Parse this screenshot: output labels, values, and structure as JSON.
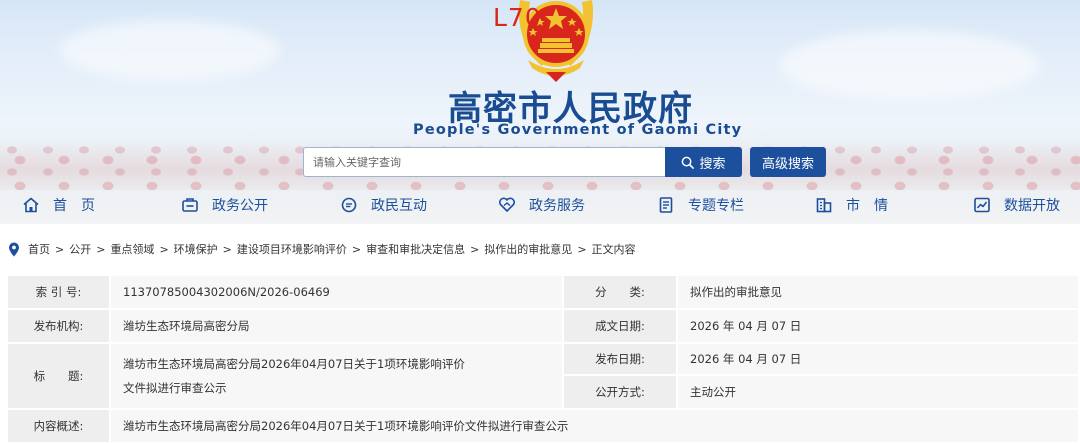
{
  "header": {
    "watermark": "L70",
    "title": "高密市人民政府",
    "subtitle": "People's Government of Gaomi City",
    "search": {
      "placeholder": "请输入关键字查询",
      "button_label": "搜索",
      "advanced_label": "高级搜索"
    }
  },
  "nav": [
    {
      "label": "首　页",
      "icon": "home-icon"
    },
    {
      "label": "政务公开",
      "icon": "folder-icon"
    },
    {
      "label": "政民互动",
      "icon": "chat-icon"
    },
    {
      "label": "政务服务",
      "icon": "service-icon"
    },
    {
      "label": "专题专栏",
      "icon": "document-icon"
    },
    {
      "label": "市　情",
      "icon": "building-icon"
    },
    {
      "label": "数据开放",
      "icon": "chart-icon"
    }
  ],
  "breadcrumb": [
    "首页",
    "公开",
    "重点领域",
    "环境保护",
    "建设项目环境影响评价",
    "审查和审批决定信息",
    "拟作出的审批意见",
    "正文内容"
  ],
  "breadcrumb_separator": ">",
  "info": {
    "index_label": "索 引 号:",
    "index_value": "11370785004302006N/2026-06469",
    "category_label": "分　　类:",
    "category_value": "拟作出的审批意见",
    "publisher_label": "发布机构:",
    "publisher_value": "潍坊生态环境局高密分局",
    "created_label": "成文日期:",
    "created_value": "2026 年 04 月 07 日",
    "title_label": "标　　题:",
    "title_value": "潍坊市生态环境局高密分局2026年04月07日关于1项环境影响评价文件拟进行审查公示",
    "published_label": "发布日期:",
    "published_value": "2026 年 04 月 07 日",
    "disclosure_label": "公开方式:",
    "disclosure_value": "主动公开",
    "summary_label": "内容概述:",
    "summary_value": "潍坊市生态环境局高密分局2026年04月07日关于1项环境影响评价文件拟进行审查公示"
  },
  "colors": {
    "brand_blue": "#1c4f9c",
    "emblem_red": "#d8261d",
    "emblem_gold": "#f2c230"
  }
}
